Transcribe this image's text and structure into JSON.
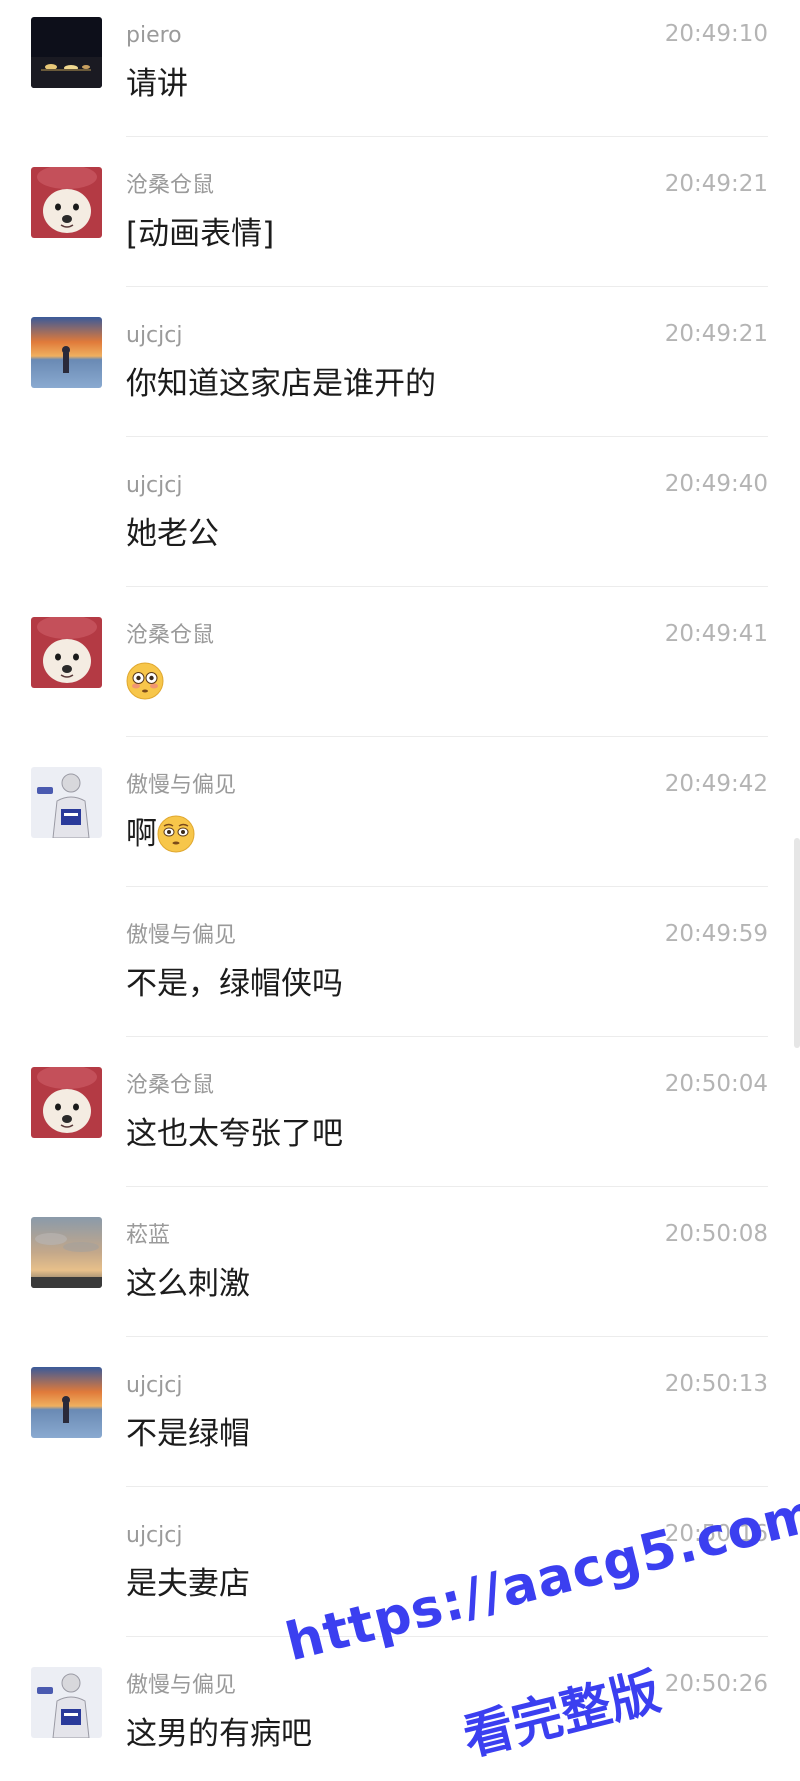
{
  "messages": [
    {
      "sender": "piero",
      "time": "20:49:10",
      "text": "请讲",
      "avatar": "night-lights-avatar"
    },
    {
      "sender": "沧桑仓鼠",
      "time": "20:49:21",
      "text": "[动画表情]",
      "avatar": "dog-hood-avatar"
    },
    {
      "sender": "ujcjcj",
      "time": "20:49:21",
      "text": "你知道这家店是谁开的",
      "avatar": "sunset-figure-avatar"
    },
    {
      "sender": "ujcjcj",
      "time": "20:49:40",
      "text": "她老公",
      "avatar": ""
    },
    {
      "sender": "沧桑仓鼠",
      "time": "20:49:41",
      "text": "",
      "emoji": "flushed-face-emoji",
      "avatar": "dog-hood-avatar"
    },
    {
      "sender": "傲慢与偏见",
      "time": "20:49:42",
      "text": "啊",
      "emoji": "dizzy-face-emoji",
      "avatar": "sketch-person-avatar"
    },
    {
      "sender": "傲慢与偏见",
      "time": "20:49:59",
      "text": "不是，绿帽侠吗",
      "avatar": ""
    },
    {
      "sender": "沧桑仓鼠",
      "time": "20:50:04",
      "text": "这也太夸张了吧",
      "avatar": "dog-hood-avatar"
    },
    {
      "sender": "菘蓝",
      "time": "20:50:08",
      "text": "这么刺激",
      "avatar": "cloudy-sky-avatar"
    },
    {
      "sender": "ujcjcj",
      "time": "20:50:13",
      "text": "不是绿帽",
      "avatar": "sunset-figure-avatar"
    },
    {
      "sender": "ujcjcj",
      "time": "20:50:16",
      "text": "是夫妻店",
      "avatar": ""
    },
    {
      "sender": "傲慢与偏见",
      "time": "20:50:26",
      "text": "这男的有病吧",
      "avatar": "sketch-person-avatar"
    }
  ],
  "watermark": {
    "url": "https://aacg5.com",
    "caption": "看完整版"
  },
  "colors": {
    "sender": "#9a9a9a",
    "time": "#b4b4b4",
    "text": "#1c1c1c",
    "divider": "#ececec",
    "watermark": "#3b3ff0"
  }
}
